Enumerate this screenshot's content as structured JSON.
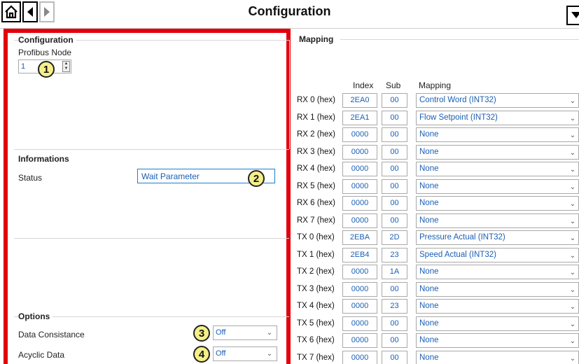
{
  "header": {
    "title": "Configuration"
  },
  "config": {
    "group_title": "Configuration",
    "profibus_node_label": "Profibus Node",
    "profibus_node_value": "1"
  },
  "informations": {
    "group_title": "Informations",
    "status_label": "Status",
    "status_value": "Wait Parameter"
  },
  "options": {
    "group_title": "Options",
    "data_consistance_label": "Data Consistance",
    "data_consistance_value": "Off",
    "acyclic_data_label": "Acyclic Data",
    "acyclic_data_value": "Off"
  },
  "callouts": [
    "1",
    "2",
    "3",
    "4"
  ],
  "mapping": {
    "title": "Mapping",
    "headers": {
      "index": "Index",
      "sub": "Sub",
      "mapping": "Mapping"
    },
    "rows": [
      {
        "label": "RX 0 (hex)",
        "index": "2EA0",
        "sub": "00",
        "mapping": "Control Word (INT32)"
      },
      {
        "label": "RX 1 (hex)",
        "index": "2EA1",
        "sub": "00",
        "mapping": "Flow Setpoint (INT32)"
      },
      {
        "label": "RX 2 (hex)",
        "index": "0000",
        "sub": "00",
        "mapping": "None"
      },
      {
        "label": "RX 3 (hex)",
        "index": "0000",
        "sub": "00",
        "mapping": "None"
      },
      {
        "label": "RX 4 (hex)",
        "index": "0000",
        "sub": "00",
        "mapping": "None"
      },
      {
        "label": "RX 5 (hex)",
        "index": "0000",
        "sub": "00",
        "mapping": "None"
      },
      {
        "label": "RX 6 (hex)",
        "index": "0000",
        "sub": "00",
        "mapping": "None"
      },
      {
        "label": "RX 7 (hex)",
        "index": "0000",
        "sub": "00",
        "mapping": "None"
      },
      {
        "label": "TX 0 (hex)",
        "index": "2EBA",
        "sub": "2D",
        "mapping": "Pressure Actual (INT32)"
      },
      {
        "label": "TX 1 (hex)",
        "index": "2EB4",
        "sub": "23",
        "mapping": "Speed Actual (INT32)"
      },
      {
        "label": "TX 2 (hex)",
        "index": "0000",
        "sub": "1A",
        "mapping": "None"
      },
      {
        "label": "TX 3 (hex)",
        "index": "0000",
        "sub": "00",
        "mapping": "None"
      },
      {
        "label": "TX 4 (hex)",
        "index": "0000",
        "sub": "23",
        "mapping": "None"
      },
      {
        "label": "TX 5 (hex)",
        "index": "0000",
        "sub": "00",
        "mapping": "None"
      },
      {
        "label": "TX 6 (hex)",
        "index": "0000",
        "sub": "00",
        "mapping": "None"
      },
      {
        "label": "TX 7 (hex)",
        "index": "0000",
        "sub": "00",
        "mapping": "None"
      }
    ]
  },
  "icons": [
    "home-icon",
    "back-icon",
    "forward-icon",
    "menu-dropdown-icon",
    "chevron-down-icon"
  ],
  "colors": {
    "highlight_border": "#e3000b",
    "value_text": "#1a5fb4",
    "callout_fill": "#f5ef89"
  }
}
